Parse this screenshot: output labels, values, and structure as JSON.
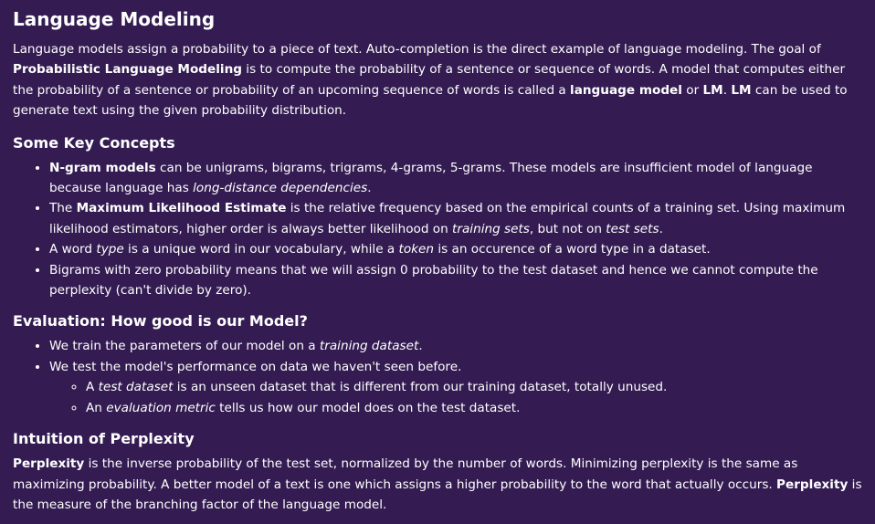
{
  "title": "Language Modeling",
  "intro": [
    {
      "t": "Language models assign a probability to a piece of text. Auto-completion is the direct example of language modeling. The goal of "
    },
    {
      "t": "Probabilistic Language Modeling",
      "b": true
    },
    {
      "t": " is to compute the probability of a sentence or sequence of words. A model that computes either the probability of a sentence or probability of an upcoming sequence of words is called a "
    },
    {
      "t": "language model",
      "b": true
    },
    {
      "t": " or "
    },
    {
      "t": "LM",
      "b": true
    },
    {
      "t": ". "
    },
    {
      "t": "LM",
      "b": true
    },
    {
      "t": " can be used to generate text using the given probability distribution."
    }
  ],
  "key_concepts": {
    "heading": "Some Key Concepts",
    "items": [
      [
        {
          "t": "N-gram models",
          "b": true
        },
        {
          "t": " can be unigrams, bigrams, trigrams, 4-grams, 5-grams. These models are insufficient model of language because language has "
        },
        {
          "t": "long-distance dependencies",
          "i": true
        },
        {
          "t": "."
        }
      ],
      [
        {
          "t": "The "
        },
        {
          "t": "Maximum Likelihood Estimate",
          "b": true
        },
        {
          "t": " is the relative frequency based on the empirical counts of a training set. Using maximum likelihood estimators, higher order is always better likelihood on "
        },
        {
          "t": "training sets",
          "i": true
        },
        {
          "t": ", but not on "
        },
        {
          "t": "test sets",
          "i": true
        },
        {
          "t": "."
        }
      ],
      [
        {
          "t": "A word "
        },
        {
          "t": "type",
          "i": true
        },
        {
          "t": " is a unique word in our vocabulary, while a "
        },
        {
          "t": "token",
          "i": true
        },
        {
          "t": " is an occurence of a word type in a dataset."
        }
      ],
      [
        {
          "t": "Bigrams with zero probability means that we will assign 0 probability to the test dataset and hence we cannot compute the perplexity (can't divide by zero)."
        }
      ]
    ]
  },
  "evaluation": {
    "heading": "Evaluation: How good is our Model?",
    "items": [
      [
        {
          "t": "We train the parameters of our model on a "
        },
        {
          "t": "training dataset",
          "i": true
        },
        {
          "t": "."
        }
      ],
      [
        {
          "t": "We test the model's performance on data we haven't seen before."
        }
      ]
    ],
    "sub_items": [
      [
        {
          "t": "A "
        },
        {
          "t": "test dataset",
          "i": true
        },
        {
          "t": " is an unseen dataset that is different from our training dataset, totally unused."
        }
      ],
      [
        {
          "t": "An "
        },
        {
          "t": "evaluation metric",
          "i": true
        },
        {
          "t": " tells us how our model does on the test dataset."
        }
      ]
    ]
  },
  "perplexity": {
    "heading": "Intuition of Perplexity",
    "paragraph": [
      {
        "t": "Perplexity",
        "b": true
      },
      {
        "t": " is the inverse probability of the test set, normalized by the number of words. Minimizing perplexity is the same as maximizing probability. A better model of a text is one which assigns a higher probability to the word that actually occurs. "
      },
      {
        "t": "Perplexity",
        "b": true
      },
      {
        "t": " is the measure of the branching factor of the language model."
      }
    ]
  },
  "colors": {
    "background": "#341c52",
    "text": "#ffffff"
  }
}
